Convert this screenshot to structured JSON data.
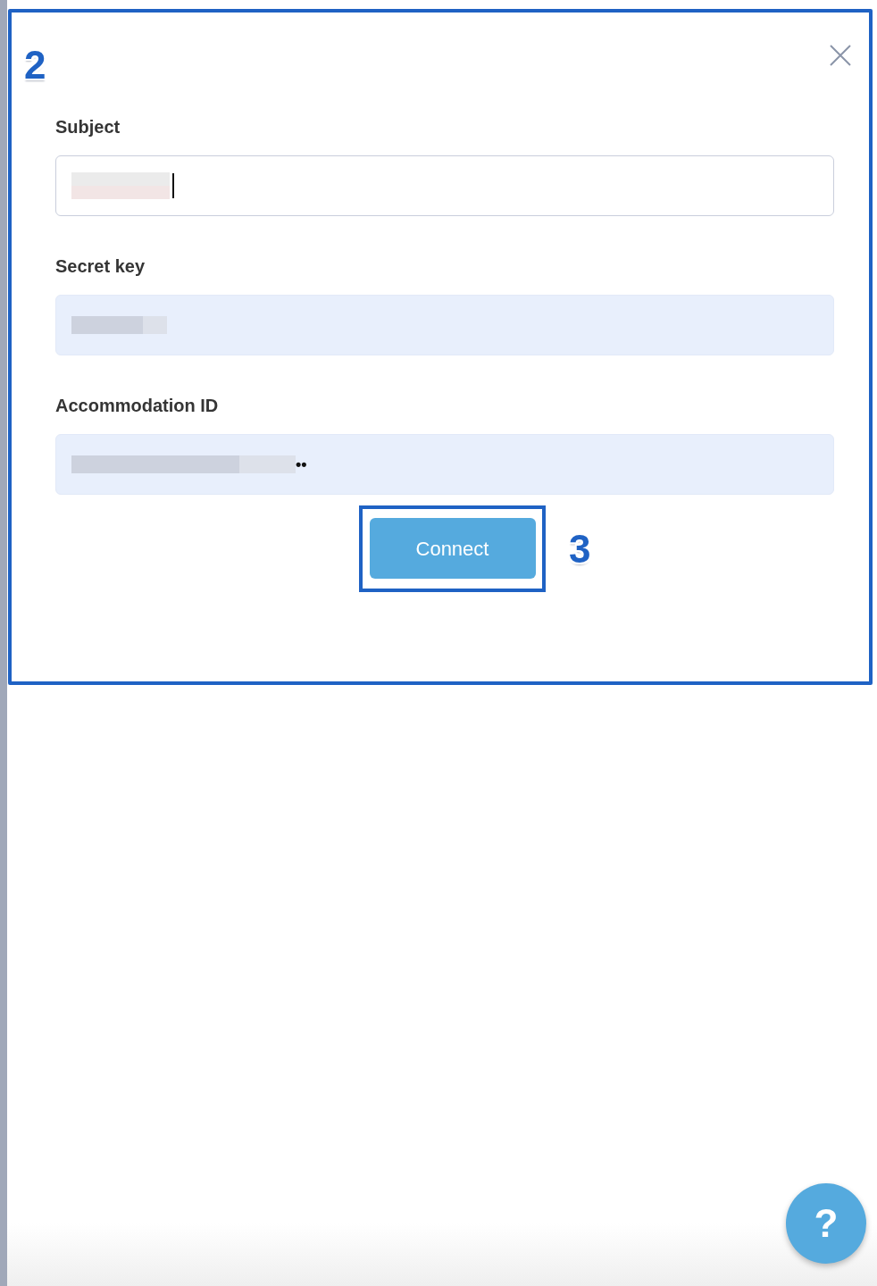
{
  "dialog": {
    "highlighted": true,
    "step_badge": "2"
  },
  "fields": [
    {
      "label": "Subject",
      "focused": true,
      "autofilled": false,
      "redacted": true
    },
    {
      "label": "Secret key",
      "focused": false,
      "autofilled": true,
      "redacted": true
    },
    {
      "label": "Accommodation ID",
      "focused": false,
      "autofilled": true,
      "redacted": true,
      "value": "••"
    }
  ],
  "connect_button": {
    "label": "Connect",
    "highlighted": true,
    "step_badge": "3"
  },
  "help_button": {
    "label": "?"
  }
}
